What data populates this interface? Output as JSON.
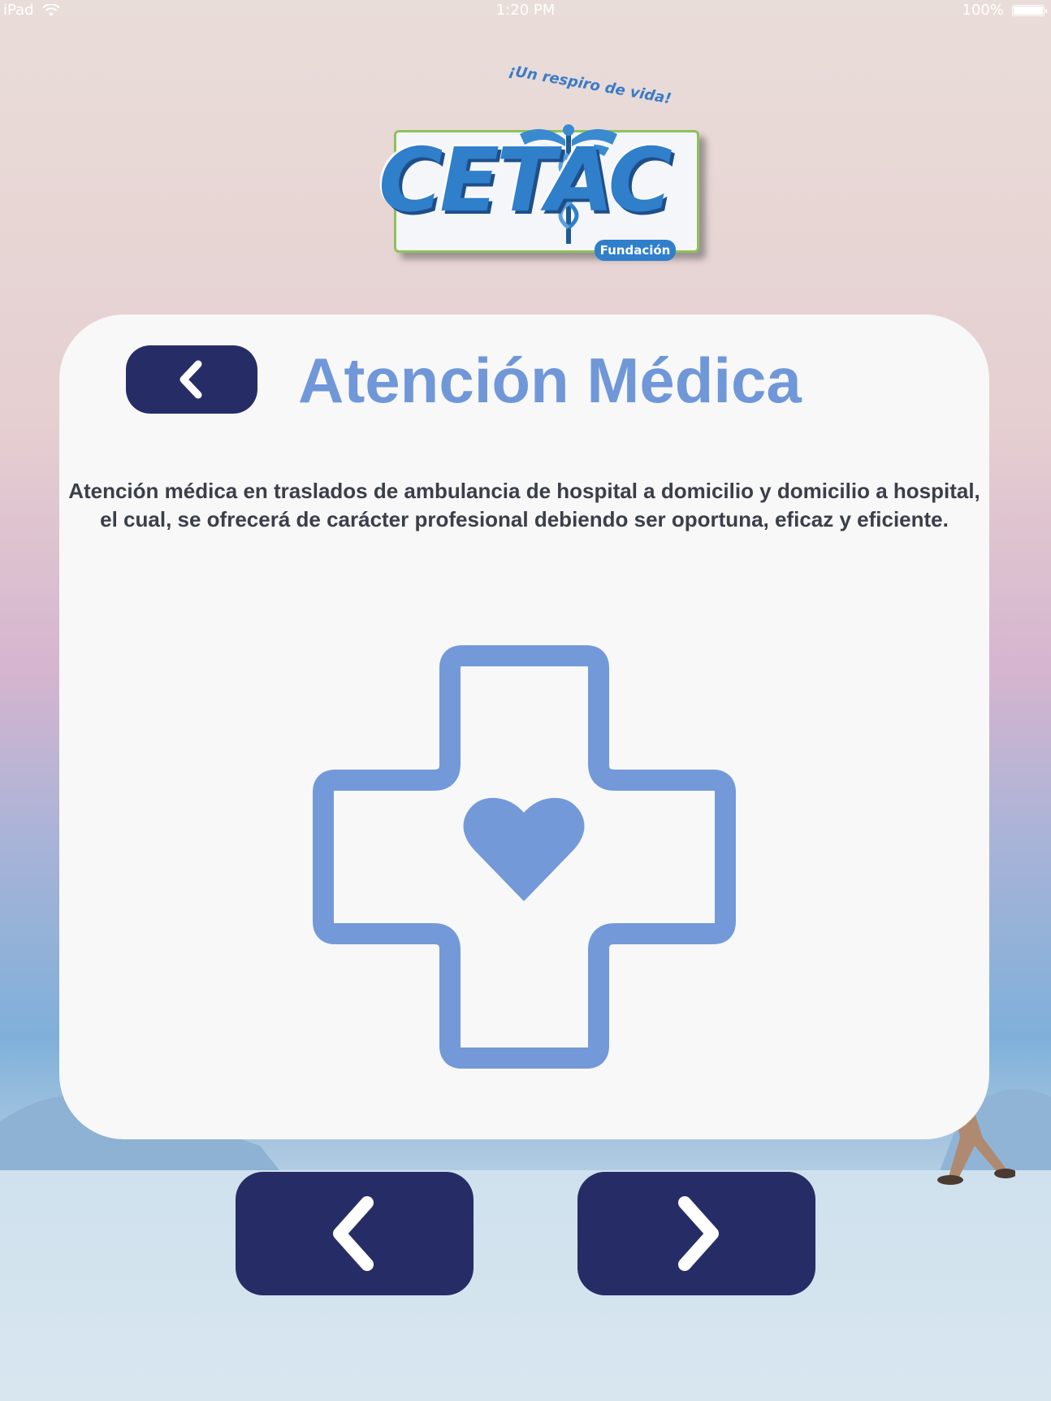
{
  "status_bar": {
    "device": "iPad",
    "time": "1:20 PM",
    "battery": "100%"
  },
  "logo": {
    "slogan": "¡Un respiro de vida!",
    "name": "CETAC",
    "badge": "Fundación"
  },
  "card": {
    "title": "Atención Médica",
    "description": "Atención médica en traslados de ambulancia de hospital a domicilio y domicilio a hospital, el cual, se ofrecerá de carácter profesional debiendo ser oportuna, eficaz y eficiente."
  },
  "colors": {
    "button": "#262d66",
    "accent": "#7097d8",
    "card": "#f8f8f8"
  },
  "icons": {
    "back": "chevron-left-icon",
    "previous": "chevron-left-icon",
    "next": "chevron-right-icon",
    "service": "medical-cross-heart-icon"
  }
}
